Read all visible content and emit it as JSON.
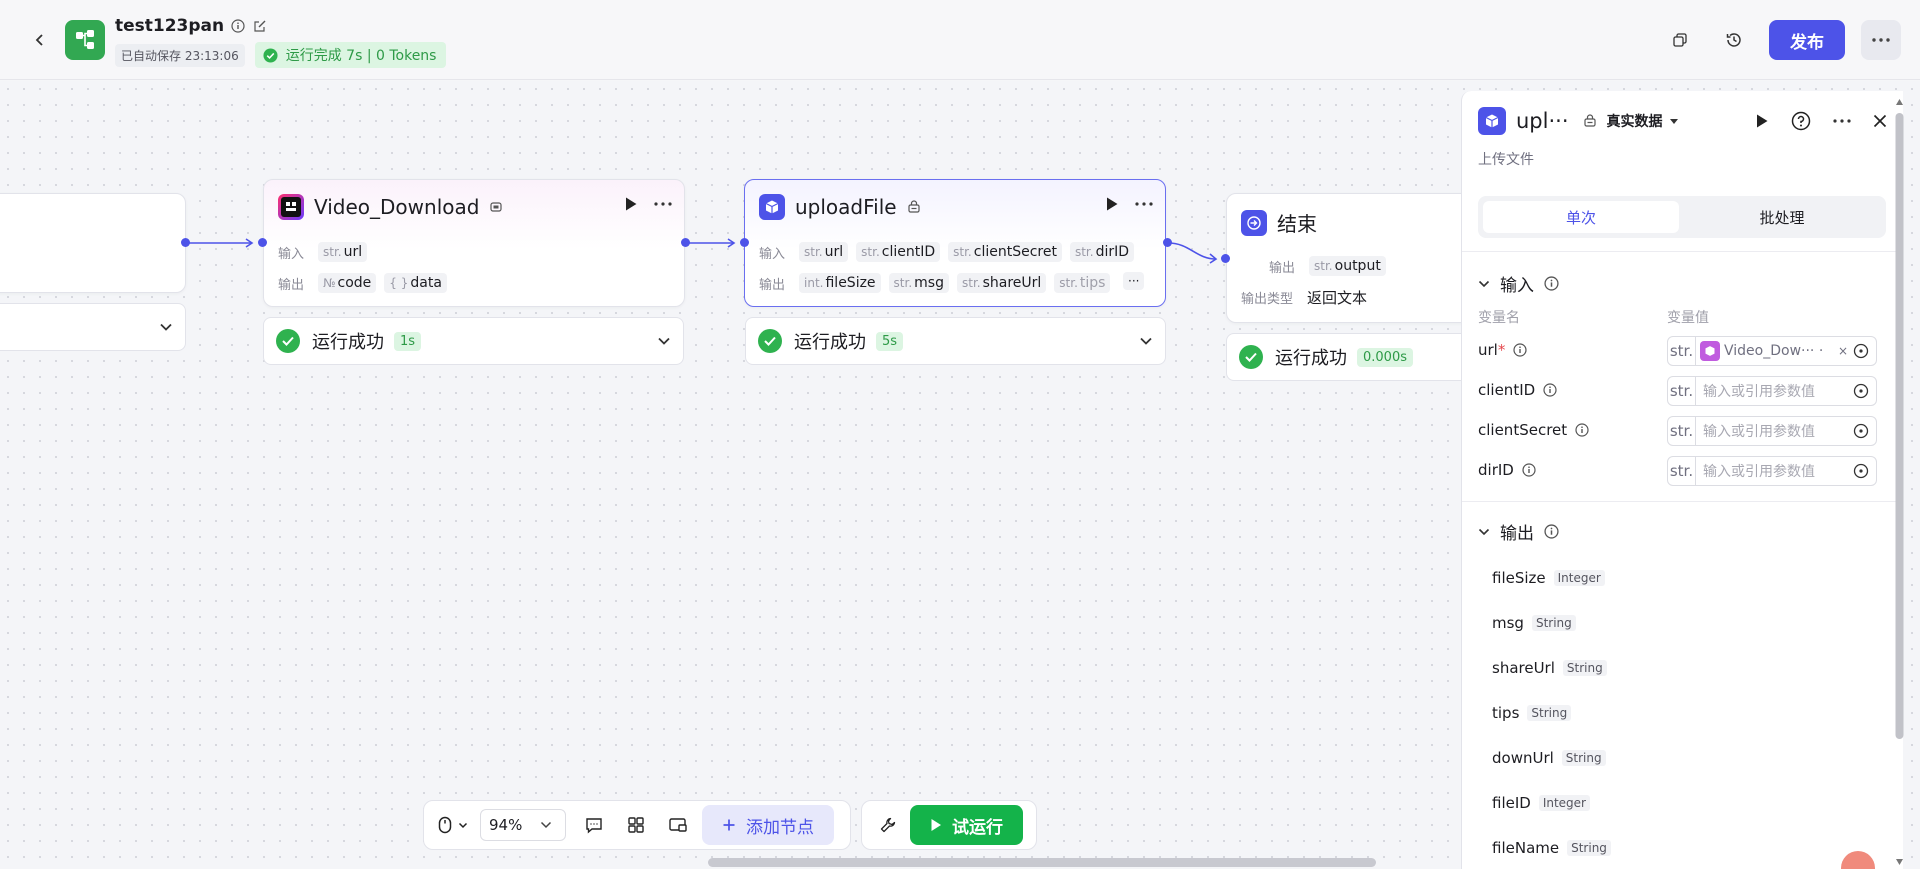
{
  "header": {
    "title": "test123pan",
    "autosave": "已自动保存 23:13:06",
    "run_status": "运行完成 7s | 0 Tokens",
    "publish_label": "发布"
  },
  "nodes": {
    "video_download": {
      "title": "Video_Download",
      "input_label": "输入",
      "output_label": "输出",
      "inputs": [
        {
          "type": "str.",
          "name": "url"
        }
      ],
      "outputs": [
        {
          "type": "№",
          "name": "code"
        },
        {
          "type": "{ }",
          "name": "data"
        }
      ],
      "status": "运行成功",
      "time": "1s"
    },
    "upload_file": {
      "title": "uploadFile",
      "input_label": "输入",
      "output_label": "输出",
      "inputs": [
        {
          "type": "str.",
          "name": "url"
        },
        {
          "type": "str.",
          "name": "clientID"
        },
        {
          "type": "str.",
          "name": "clientSecret"
        },
        {
          "type": "str.",
          "name": "dirID"
        }
      ],
      "outputs": [
        {
          "type": "int.",
          "name": "fileSize"
        },
        {
          "type": "str.",
          "name": "msg"
        },
        {
          "type": "str.",
          "name": "shareUrl"
        },
        {
          "type": "str.",
          "name": "tips"
        }
      ],
      "more": "···",
      "status": "运行成功",
      "time": "5s"
    },
    "end": {
      "title": "结束",
      "output_label": "输出",
      "outputs": [
        {
          "type": "str.",
          "name": "output"
        }
      ],
      "output_type_label": "输出类型",
      "output_type_value": "返回文本",
      "status": "运行成功",
      "time": "0.000s"
    }
  },
  "toolbar": {
    "zoom": "94%",
    "add_node": "添加节点",
    "test_run": "试运行"
  },
  "panel": {
    "title": "upl···",
    "mode": "真实数据",
    "description": "上传文件",
    "tab_single": "单次",
    "tab_batch": "批处理",
    "input_section": "输入",
    "col_name": "变量名",
    "col_value": "变量值",
    "variables": [
      {
        "name": "url",
        "required": "*",
        "type": "str.",
        "ref": "Video_Dow··· ·",
        "clear": "×"
      },
      {
        "name": "clientID",
        "type": "str.",
        "placeholder": "输入或引用参数值"
      },
      {
        "name": "clientSecret",
        "type": "str.",
        "placeholder": "输入或引用参数值"
      },
      {
        "name": "dirID",
        "type": "str.",
        "placeholder": "输入或引用参数值"
      }
    ],
    "output_section": "输出",
    "outputs": [
      {
        "name": "fileSize",
        "type": "Integer"
      },
      {
        "name": "msg",
        "type": "String"
      },
      {
        "name": "shareUrl",
        "type": "String"
      },
      {
        "name": "tips",
        "type": "String"
      },
      {
        "name": "downUrl",
        "type": "String"
      },
      {
        "name": "fileID",
        "type": "Integer"
      },
      {
        "name": "fileName",
        "type": "String"
      }
    ]
  },
  "colors": {
    "primary": "#4d53e8",
    "success": "#2fb24f",
    "test_run": "#14b34a"
  }
}
